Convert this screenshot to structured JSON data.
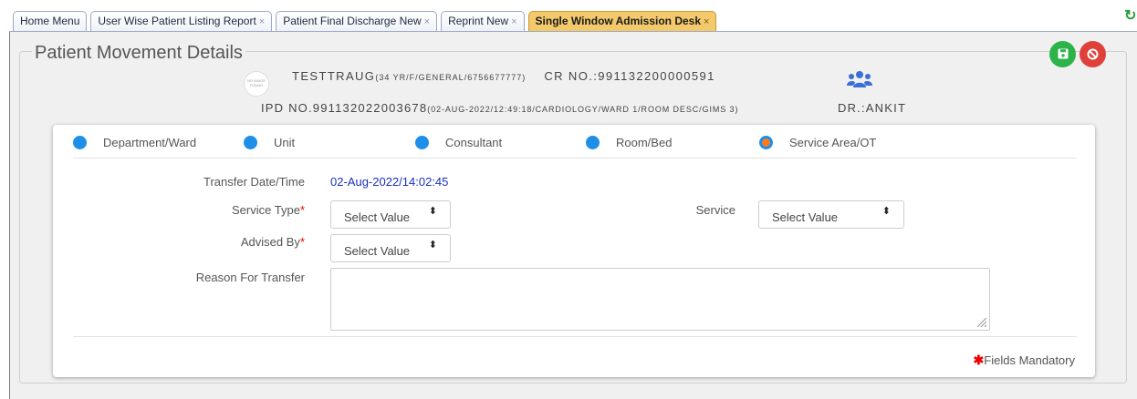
{
  "tabs": [
    {
      "label": "Home Menu",
      "closable": false,
      "active": false
    },
    {
      "label": "User Wise Patient Listing Report",
      "closable": true,
      "active": false
    },
    {
      "label": "Patient Final Discharge New",
      "closable": true,
      "active": false
    },
    {
      "label": "Reprint New",
      "closable": true,
      "active": false
    },
    {
      "label": "Single Window Admission Desk",
      "closable": true,
      "active": true
    }
  ],
  "tab_close_glyph": "×",
  "refresh_glyph": "↻",
  "page_title": "Patient Movement Details",
  "no_image_text": "NO IMAGE FOUND",
  "patient": {
    "name": "TESTTRAUG",
    "details": "(34 YR/F/GENERAL/6756677777)",
    "cr_label": "CR NO.:",
    "cr_no": "991132200000591",
    "ipd_label": "IPD NO.",
    "ipd_no": "991132022003678",
    "ipd_details": "(02-AUG-2022/12:49:18/CARDIOLOGY/WARD 1/ROOM DESC/GIMS 3)",
    "doctor": "DR.:ANKIT"
  },
  "movement_options": [
    {
      "label": "Department/Ward",
      "selected": false
    },
    {
      "label": "Unit",
      "selected": false
    },
    {
      "label": "Consultant",
      "selected": false
    },
    {
      "label": "Room/Bed",
      "selected": false
    },
    {
      "label": "Service Area/OT",
      "selected": true
    }
  ],
  "form": {
    "transfer_label": "Transfer Date/Time",
    "transfer_value": "02-Aug-2022/14:02:45",
    "service_type_label": "Service Type",
    "service_type_value": "Select Value",
    "service_label": "Service",
    "service_value": "Select Value",
    "advised_by_label": "Advised By",
    "advised_by_value": "Select Value",
    "reason_label": "Reason For Transfer",
    "required_mark": "*",
    "mandatory_note": "Fields Mandatory",
    "mandatory_star": "✱",
    "select_arrows": "⬍"
  },
  "icons": {
    "save": "save-icon",
    "cancel": "cancel-icon",
    "users": "users-icon"
  },
  "colors": {
    "active_tab": "#f3c96c",
    "save_button": "#2db34a",
    "cancel_button": "#e0403a",
    "radio": "#1e8fe8",
    "radio_selected_center": "#ff7a1a",
    "date_value": "#1a2fc0",
    "users_icon": "#3a6fd8"
  }
}
